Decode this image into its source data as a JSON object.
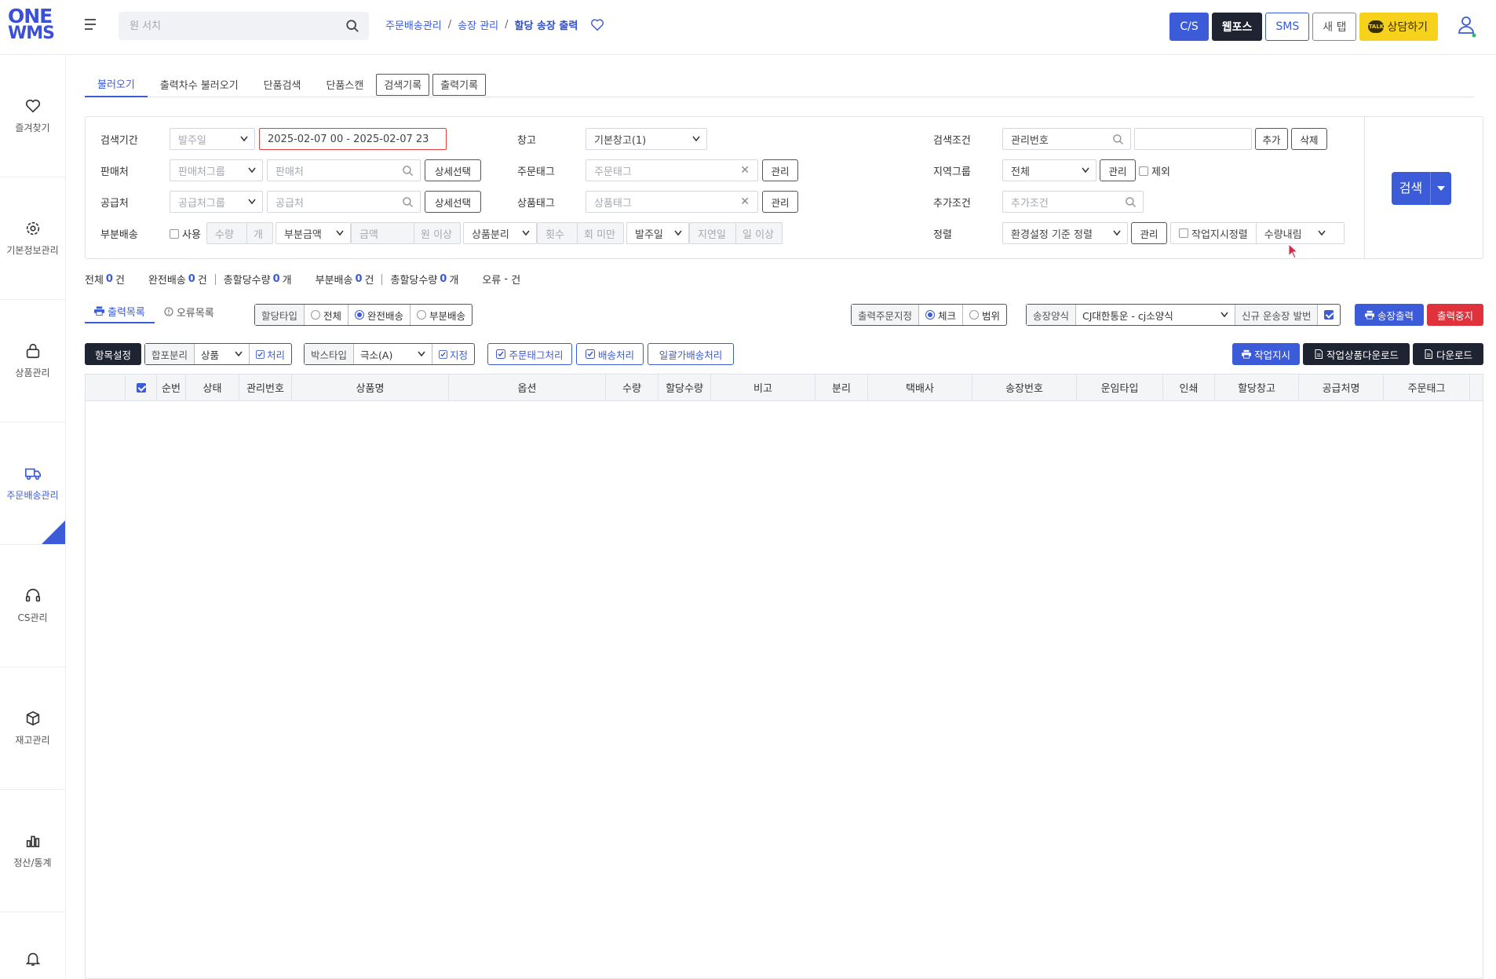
{
  "header": {
    "logo_line1": "ONE",
    "logo_line2": "WMS",
    "search_placeholder": "원 서치",
    "breadcrumb": [
      "주문배송관리",
      "송장 관리",
      "할당 송장 출력"
    ],
    "buttons": {
      "cs": "C/S",
      "webpos": "웹포스",
      "sms": "SMS",
      "newtab": "새 탭",
      "chat": "상담하기",
      "talk": "TALK"
    }
  },
  "sidebar": {
    "items": [
      {
        "label": "즐겨찾기",
        "icon": "heart-icon"
      },
      {
        "label": "기본정보관리",
        "icon": "gear-icon"
      },
      {
        "label": "상품관리",
        "icon": "lock-bag-icon"
      },
      {
        "label": "주문배송관리",
        "icon": "truck-icon",
        "active": true
      },
      {
        "label": "CS관리",
        "icon": "headset-icon"
      },
      {
        "label": "재고관리",
        "icon": "box-icon"
      },
      {
        "label": "정산/통계",
        "icon": "bar-chart-icon"
      },
      {
        "label": "알림",
        "icon": "bell-icon"
      }
    ]
  },
  "tabs": {
    "load": "불러오기",
    "load_batch": "출력차수 불러오기",
    "single_search": "단품검색",
    "single_scan": "단품스캔",
    "search_history": "검색기록",
    "print_history": "출력기록"
  },
  "filters": {
    "period_label": "검색기간",
    "period_type": "발주일",
    "period_value": "2025-02-07 00 - 2025-02-07 23",
    "seller_label": "판매처",
    "seller_group_ph": "판매처그룹",
    "seller_ph": "판매처",
    "detail_select": "상세선택",
    "supplier_label": "공급처",
    "supplier_group_ph": "공급처그룹",
    "supplier_ph": "공급처",
    "partial_label": "부분배송",
    "partial_use": "사용",
    "qty_ph": "수량",
    "qty_unit": "개",
    "partial_amount": "부분금액",
    "amount_ph": "금액",
    "amount_unit": "원 이상",
    "product_split": "상품분리",
    "count_ph": "횟수",
    "count_unit": "회 미만",
    "order_date": "발주일",
    "delay_ph": "지연일",
    "delay_unit": "일 이상",
    "warehouse_label": "창고",
    "warehouse_value": "기본창고(1)",
    "order_tag_label": "주문태그",
    "order_tag_ph": "주문태그",
    "manage": "관리",
    "product_tag_label": "상품태그",
    "product_tag_ph": "상품태그",
    "cond_label": "검색조건",
    "cond_value": "관리번호",
    "add": "추가",
    "delete": "삭제",
    "region_label": "지역그룹",
    "region_value": "전체",
    "exclude": "제외",
    "extra_label": "추가조건",
    "extra_ph": "추가조건",
    "sort_label": "정렬",
    "sort_value": "환경설정 기준 정렬",
    "work_sort": "작업지시정렬",
    "qty_desc": "수량내림",
    "search_btn": "검색"
  },
  "summary": {
    "total_label": "전체",
    "total": "0",
    "unit_gun": "건",
    "full_label": "완전배송",
    "full": "0",
    "alloc_label": "총할당수량",
    "alloc_full": "0",
    "unit_gae": "개",
    "partial_label": "부분배송",
    "partial": "0",
    "alloc_partial": "0",
    "error_label": "오류",
    "error": "-"
  },
  "list": {
    "tab_print": "출력목록",
    "tab_error": "오류목록",
    "alloc_type": "할당타입",
    "all": "전체",
    "full": "완전배송",
    "partial": "부분배송",
    "print_order": "출력주문지정",
    "check": "체크",
    "range": "범위",
    "invoice_format": "송장양식",
    "invoice_value": "CJ대한통운 - cj소양식",
    "new_invoice": "신규 운송장 발번",
    "print_invoice": "송장출력",
    "stop_print": "출력중지",
    "item_setting": "항목설정",
    "merge_split": "합포분리",
    "product": "상품",
    "process": "처리",
    "box_type": "박스타입",
    "box_value": "극소(A)",
    "assign": "지정",
    "order_tag_process": "주문태그처리",
    "ship_process": "배송처리",
    "bulk_ship": "일괄가배송처리",
    "work_order": "작업지시",
    "work_download": "작업상품다운로드",
    "download": "다운로드"
  },
  "grid": {
    "columns": [
      "순번",
      "상태",
      "관리번호",
      "상품명",
      "옵션",
      "수량",
      "할당수량",
      "비고",
      "분리",
      "택배사",
      "송장번호",
      "운임타입",
      "인쇄",
      "할당창고",
      "공급처명",
      "주문태그"
    ]
  },
  "colors": {
    "accent": "#3b5bd8",
    "danger": "#e0323c",
    "dark": "#1f2433",
    "chat": "#f7d21c"
  }
}
